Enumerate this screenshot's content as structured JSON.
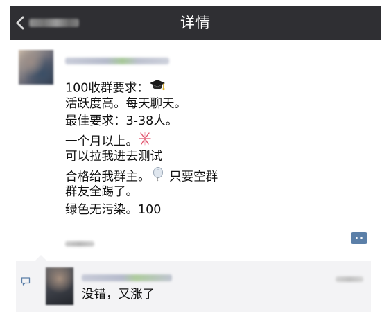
{
  "navbar": {
    "title": "详情"
  },
  "post": {
    "lines": [
      {
        "text": "100收群要求：",
        "emoji": "graduation-cap"
      },
      {
        "text": "活跃度高。每天聊天。"
      },
      {
        "text": "最佳要求：3-38人。"
      },
      {
        "text": "一个月以上。",
        "emoji": "fireworks"
      },
      {
        "text": "可以拉我进去测试"
      },
      {
        "text": "合格给我群主。",
        "emoji": "balloon",
        "suffix": " 只要空群"
      },
      {
        "text": "群友全踢了。"
      },
      {
        "text": "绿色无污染。100"
      }
    ]
  },
  "comments": [
    {
      "text": "没错，又涨了"
    }
  ]
}
